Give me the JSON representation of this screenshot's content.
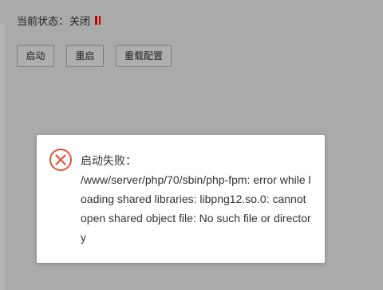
{
  "status": {
    "label": "当前状态：",
    "value": "关闭",
    "icon": "pause-icon",
    "icon_color": "#c40000"
  },
  "buttons": {
    "start_label": "启动",
    "restart_label": "重启",
    "reload_label": "重载配置"
  },
  "dialog": {
    "icon": "error-circle-x-icon",
    "icon_color": "#e0533c",
    "title": "启动失败：",
    "message": "/www/server/php/70/sbin/php-fpm: error while loading shared libraries: libpng12.so.0: cannot open shared object file: No such file or directory"
  }
}
